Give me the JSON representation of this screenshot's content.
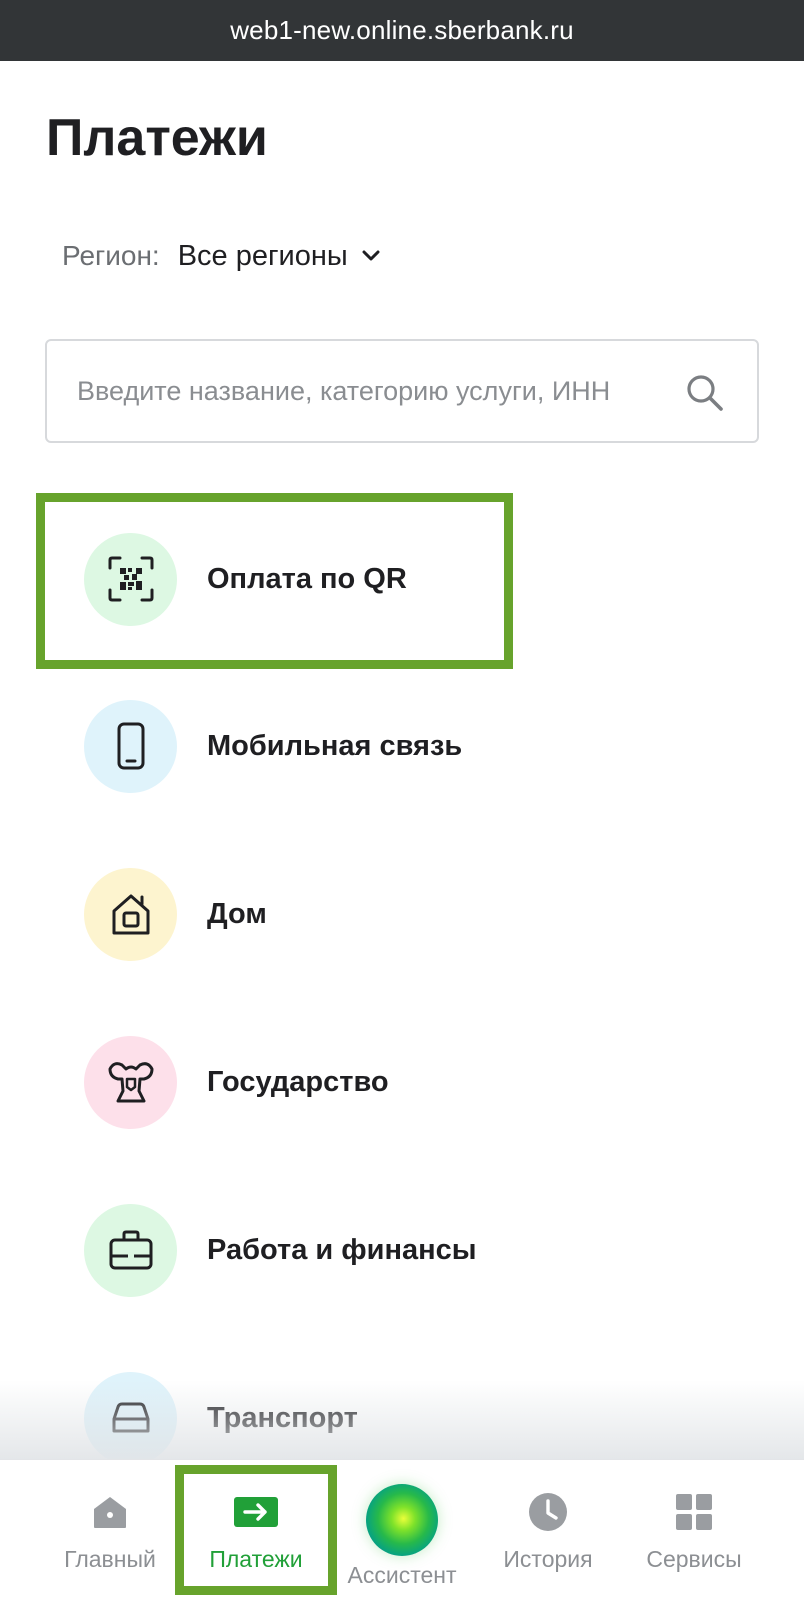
{
  "browser": {
    "url": "web1-new.online.sberbank.ru"
  },
  "header": {
    "title": "Платежи"
  },
  "region": {
    "label": "Регион:",
    "value": "Все регионы"
  },
  "search": {
    "placeholder": "Введите название, категорию услуги, ИНН"
  },
  "categories": [
    {
      "label": "Оплата по QR",
      "icon": "qr-scan-icon",
      "circle_color": "#ddf8e3",
      "highlighted": true
    },
    {
      "label": "Мобильная связь",
      "icon": "phone-icon",
      "circle_color": "#dff3fb"
    },
    {
      "label": "Дом",
      "icon": "home-icon",
      "circle_color": "#fdf4cf"
    },
    {
      "label": "Государство",
      "icon": "coat-of-arms-icon",
      "circle_color": "#fde0ea"
    },
    {
      "label": "Работа и финансы",
      "icon": "briefcase-icon",
      "circle_color": "#ddf8e3"
    },
    {
      "label": "Транспорт",
      "icon": "car-icon",
      "circle_color": "#dff3fb"
    }
  ],
  "tabbar": {
    "items": [
      {
        "label": "Главный",
        "icon": "home-icon",
        "active": false
      },
      {
        "label": "Платежи",
        "icon": "payment-arrow-icon",
        "active": true
      },
      {
        "label": "Ассистент",
        "icon": "assistant-orb-icon",
        "active": false
      },
      {
        "label": "История",
        "icon": "clock-icon",
        "active": false
      },
      {
        "label": "Сервисы",
        "icon": "grid-icon",
        "active": false
      }
    ]
  },
  "colors": {
    "brand_green": "#21a038",
    "highlight": "#67a32c",
    "text": "#1f1f22",
    "muted": "#8c8f93"
  }
}
